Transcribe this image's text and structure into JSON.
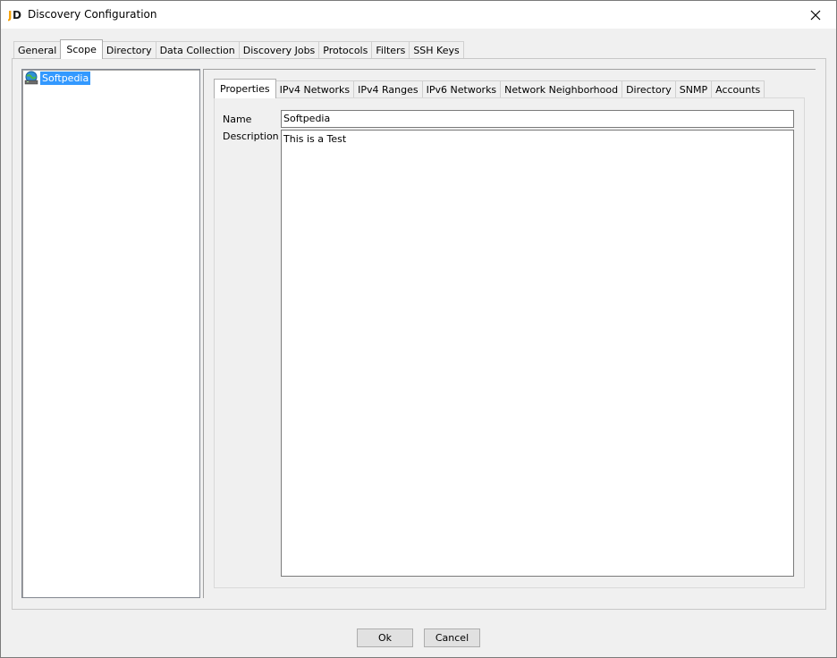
{
  "window": {
    "title": "Discovery Configuration",
    "app_icon": "jd-logo-icon",
    "close_icon": "close-icon"
  },
  "main_tabs": [
    {
      "label": "General",
      "active": false
    },
    {
      "label": "Scope",
      "active": true
    },
    {
      "label": "Directory",
      "active": false
    },
    {
      "label": "Data Collection",
      "active": false
    },
    {
      "label": "Discovery Jobs",
      "active": false
    },
    {
      "label": "Protocols",
      "active": false
    },
    {
      "label": "Filters",
      "active": false
    },
    {
      "label": "SSH Keys",
      "active": false
    }
  ],
  "tree": {
    "items": [
      {
        "label": "Softpedia",
        "icon": "network-globe-icon",
        "selected": true
      }
    ]
  },
  "sub_tabs": [
    {
      "label": "Properties",
      "active": true
    },
    {
      "label": "IPv4 Networks",
      "active": false
    },
    {
      "label": "IPv4 Ranges",
      "active": false
    },
    {
      "label": "IPv6 Networks",
      "active": false
    },
    {
      "label": "Network Neighborhood",
      "active": false
    },
    {
      "label": "Directory",
      "active": false
    },
    {
      "label": "SNMP",
      "active": false
    },
    {
      "label": "Accounts",
      "active": false
    }
  ],
  "properties": {
    "name_label": "Name",
    "name_value": "Softpedia",
    "description_label": "Description",
    "description_value": "This is a Test"
  },
  "buttons": {
    "ok": "Ok",
    "cancel": "Cancel"
  },
  "colors": {
    "selection": "#3399ff",
    "window_bg": "#f0f0f0"
  }
}
